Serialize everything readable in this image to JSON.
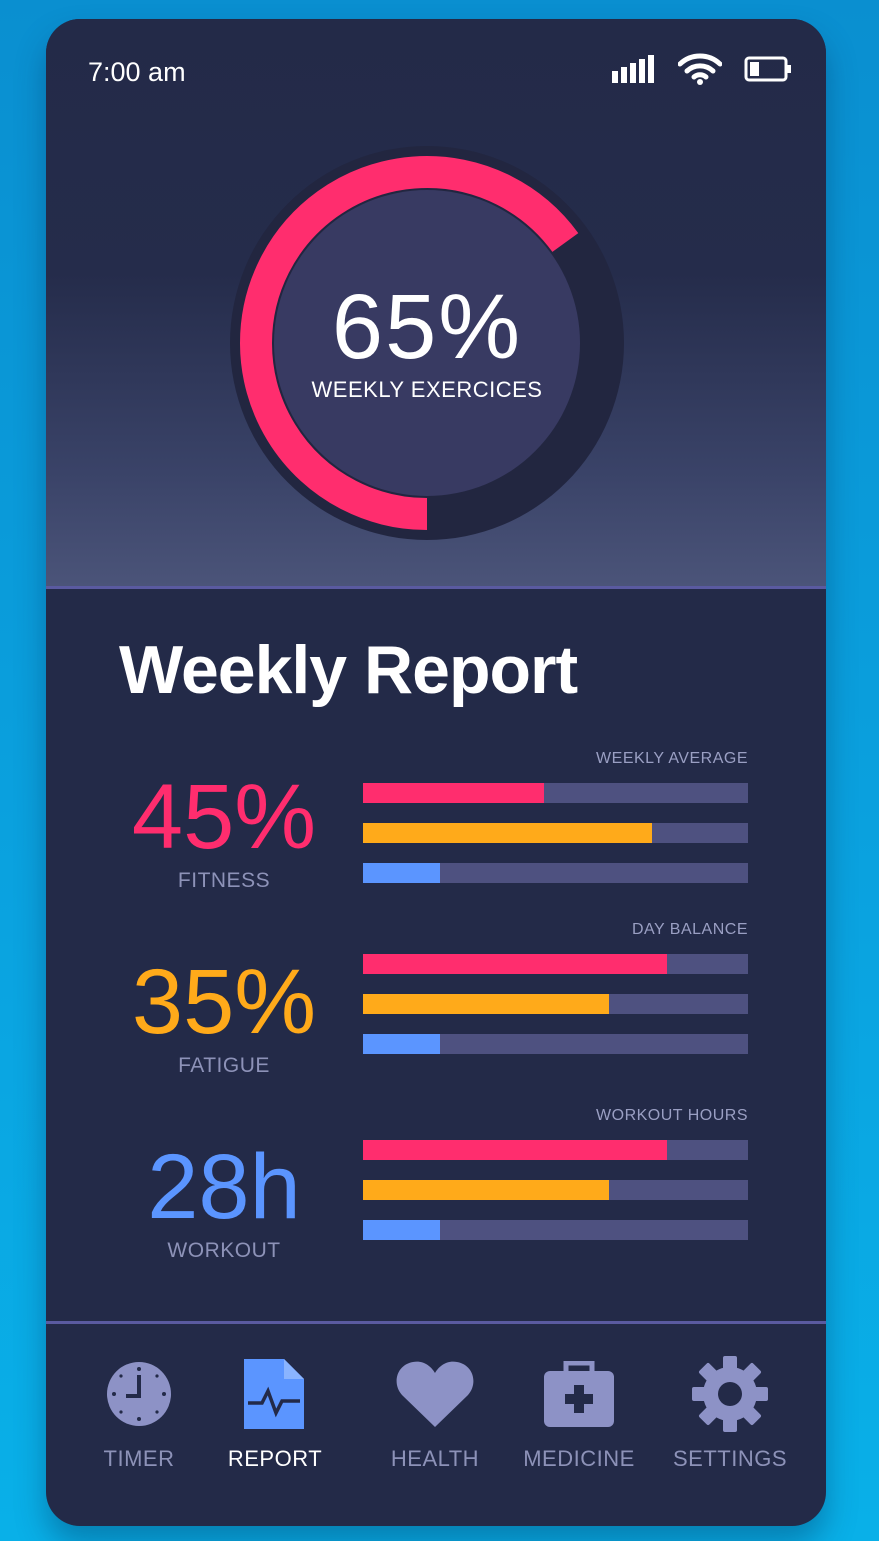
{
  "status_bar": {
    "time": "7:00 am",
    "signal_icon": "signal-bars-icon",
    "wifi_icon": "wifi-icon",
    "battery_icon": "battery-icon"
  },
  "gauge": {
    "value": "65%",
    "label": "WEEKLY EXERCICES",
    "progress": 0.65,
    "color": "#ff2d6e"
  },
  "report": {
    "title": "Weekly Report",
    "stats": [
      {
        "value": "45%",
        "label": "FITNESS",
        "color": "#ff2d6e"
      },
      {
        "value": "35%",
        "label": "FATIGUE",
        "color": "#ffaa1a"
      },
      {
        "value": "28h",
        "label": "WORKOUT",
        "color": "#5b95ff"
      }
    ],
    "groups": [
      {
        "label": "WEEKLY AVERAGE",
        "bars": [
          0.47,
          0.75,
          0.2
        ]
      },
      {
        "label": "DAY BALANCE",
        "bars": [
          0.79,
          0.64,
          0.2
        ]
      },
      {
        "label": "WORKOUT HOURS",
        "bars": [
          0.79,
          0.64,
          0.2
        ]
      }
    ],
    "bar_colors": [
      "#ff2d6e",
      "#ffaa1a",
      "#5b95ff"
    ]
  },
  "nav": {
    "items": [
      {
        "label": "TIMER",
        "icon": "clock-icon"
      },
      {
        "label": "REPORT",
        "icon": "report-document-icon",
        "active": true
      },
      {
        "label": "HEALTH",
        "icon": "heart-icon"
      },
      {
        "label": "MEDICINE",
        "icon": "medical-kit-icon"
      },
      {
        "label": "SETTINGS",
        "icon": "gear-icon"
      }
    ]
  }
}
